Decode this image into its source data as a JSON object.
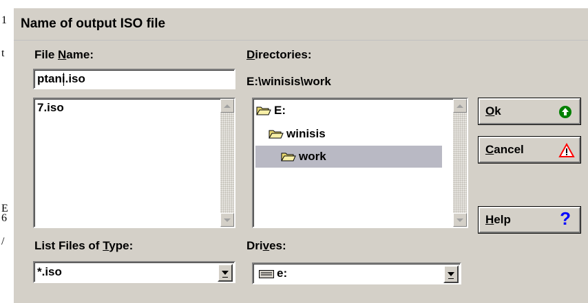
{
  "background_fragments": [
    "1",
    "t",
    "E",
    "6",
    "/"
  ],
  "dialog": {
    "title": "Name of output ISO file",
    "file_name": {
      "label_pre": "File ",
      "label_key": "N",
      "label_post": "ame:",
      "value": "ptani.iso",
      "files": [
        "7.iso"
      ]
    },
    "directories": {
      "label_key": "D",
      "label_post": "irectories:",
      "path": "E:\\winisis\\work",
      "items": [
        {
          "label": "E:",
          "state": "open"
        },
        {
          "label": "winisis",
          "state": "open"
        },
        {
          "label": "work",
          "state": "open-selected"
        }
      ]
    },
    "file_type": {
      "label_pre": "List Files of ",
      "label_key": "T",
      "label_post": "ype:",
      "value": "*.iso"
    },
    "drives": {
      "label_pre": "Dri",
      "label_key": "v",
      "label_post": "es:",
      "value": "e:"
    },
    "buttons": {
      "ok_key": "O",
      "ok_rest": "k",
      "cancel_key": "C",
      "cancel_rest": "ancel",
      "help_key": "H",
      "help_rest": "elp"
    },
    "colors": {
      "dialog_face": "#d4d0c8",
      "selection": "#b9b9c4",
      "ok_icon": "#008000",
      "help_icon": "#0000ff",
      "warning_icon": "#ff0000"
    },
    "icons": [
      "folder-open-icon",
      "ok-arrow-icon",
      "warning-icon",
      "help-icon",
      "drive-icon"
    ]
  }
}
